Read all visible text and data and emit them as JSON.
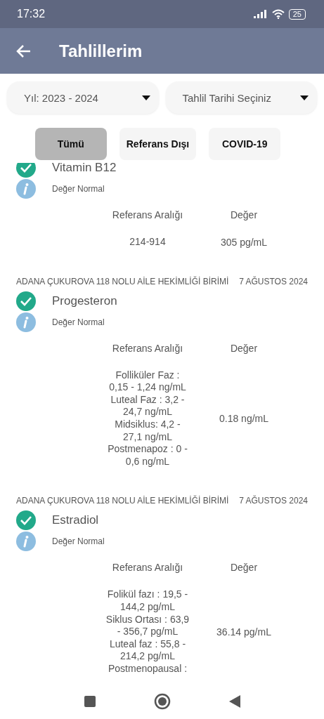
{
  "status_bar": {
    "time": "17:32",
    "battery": "25"
  },
  "app_bar": {
    "title": "Tahlillerim"
  },
  "filters": [
    {
      "label": "Yıl: 2023 - 2024"
    },
    {
      "label": "Tahlil Tarihi Seçiniz"
    }
  ],
  "chips": [
    {
      "label": "Tümü",
      "selected": true
    },
    {
      "label": "Referans Dışı",
      "selected": false
    },
    {
      "label": "COVID-19",
      "selected": false
    }
  ],
  "results": [
    {
      "name": "Vitamin B12",
      "normal": true,
      "status": "Değer Normal",
      "reference_header": "Referans Aralığı",
      "value_header": "Değer",
      "reference_lines": [
        "214-914"
      ],
      "value": "305 pg/mL"
    },
    {
      "lab": "ADANA ÇUKUROVA 118 NOLU AİLE HEKİMLİĞİ BİRİMİ",
      "date": "7 AĞUSTOS 2024",
      "name": "Progesteron",
      "normal": true,
      "status": "Değer Normal",
      "reference_header": "Referans Aralığı",
      "value_header": "Değer",
      "reference_lines": [
        "Folliküler Faz  :",
        "0,15 - 1,24 ng/mL",
        "Luteal Faz : 3,2 -",
        "24,7 ng/mL",
        "Midsiklus: 4,2 -",
        "27,1  ng/mL",
        "Postmenapoz : 0 -",
        "0,6 ng/mL"
      ],
      "value": "0.18 ng/mL"
    },
    {
      "lab": "ADANA ÇUKUROVA 118 NOLU AİLE HEKİMLİĞİ BİRİMİ",
      "date": "7 AĞUSTOS 2024",
      "name": "Estradiol",
      "normal": true,
      "status": "Değer Normal",
      "reference_header": "Referans Aralığı",
      "value_header": "Değer",
      "reference_lines": [
        "Folikül fazı : 19,5 -",
        "144,2 pg/mL",
        "Siklus Ortası : 63,9",
        "- 356,7 pg/mL",
        "Luteal faz : 55,8 -",
        "214,2 pg/mL",
        "Postmenopausal :"
      ],
      "value": "36.14 pg/mL"
    }
  ]
}
